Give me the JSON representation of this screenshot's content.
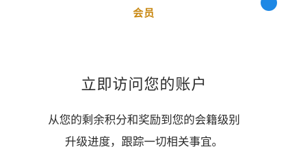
{
  "header": {
    "tab_label": "会员",
    "accent_color": "#c8860e",
    "corner_icon": "profile-badge-icon",
    "corner_icon_color": "#1e88e5"
  },
  "main": {
    "headline": "立即访问您的账户",
    "body_lines": [
      "从您的剩余积分和奖励到您的会籍级别",
      "升级进度，跟踪一切相关事宜。"
    ]
  }
}
